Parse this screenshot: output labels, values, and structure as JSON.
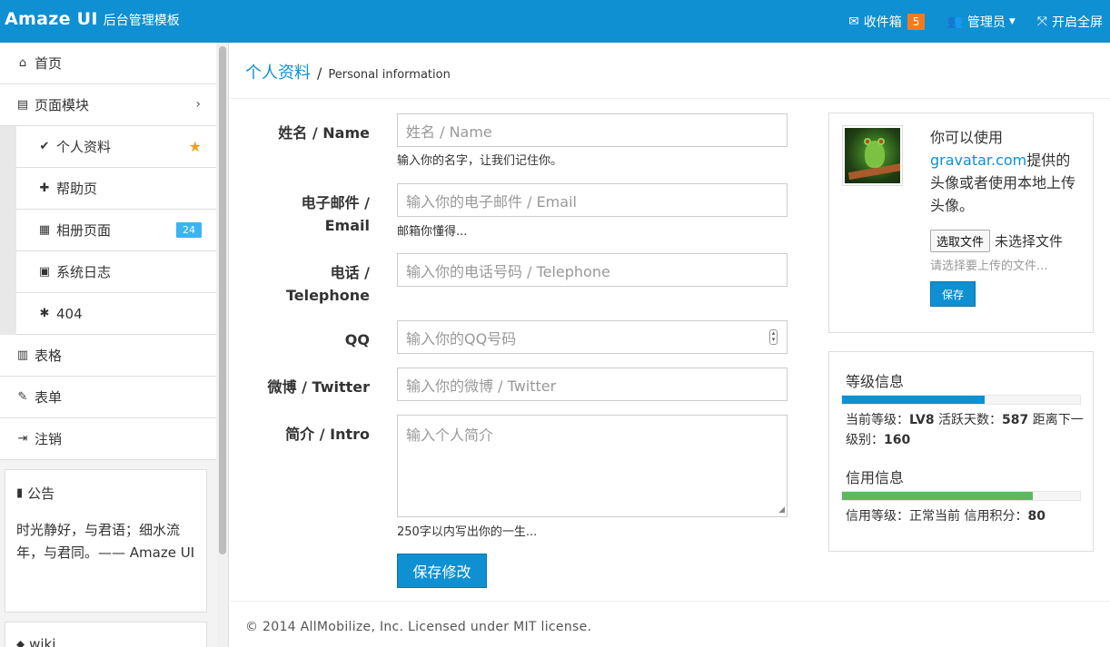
{
  "header": {
    "brand": "Amaze UI",
    "subtitle": "后台管理模板",
    "inbox_label": "收件箱",
    "inbox_count": "5",
    "admin_label": "管理员",
    "fullscreen_label": "开启全屏"
  },
  "sidebar": {
    "items": [
      {
        "label": "首页",
        "icon": "home-icon"
      },
      {
        "label": "页面模块",
        "icon": "file-icon"
      },
      {
        "label": "个人资料",
        "icon": "check-icon"
      },
      {
        "label": "帮助页",
        "icon": "puzzle-icon"
      },
      {
        "label": "相册页面",
        "icon": "grid-icon",
        "badge": "24"
      },
      {
        "label": "系统日志",
        "icon": "calendar-icon"
      },
      {
        "label": "404",
        "icon": "bug-icon"
      },
      {
        "label": "表格",
        "icon": "table-icon"
      },
      {
        "label": "表单",
        "icon": "edit-icon"
      },
      {
        "label": "注销",
        "icon": "sign-out-icon"
      }
    ],
    "notice": {
      "title": "公告",
      "body": "时光静好，与君语；细水流年，与君同。—— Amaze UI"
    },
    "wiki": {
      "title": "wiki"
    }
  },
  "page": {
    "title_zh": "个人资料",
    "title_sep": "/",
    "title_en": "Personal information"
  },
  "form": {
    "name_label": "姓名 / Name",
    "name_placeholder": "姓名 / Name",
    "name_help": "输入你的名字，让我们记住你。",
    "email_label_1": "电子邮件 /",
    "email_label_2": "Email",
    "email_placeholder": "输入你的电子邮件 / Email",
    "email_help": "邮箱你懂得...",
    "phone_label_1": "电话 /",
    "phone_label_2": "Telephone",
    "phone_placeholder": "输入你的电话号码 / Telephone",
    "qq_label": "QQ",
    "qq_placeholder": "输入你的QQ号码",
    "weibo_label": "微博 / Twitter",
    "weibo_placeholder": "输入你的微博 / Twitter",
    "intro_label": "简介 / Intro",
    "intro_placeholder": "输入个人简介",
    "intro_help": "250字以内写出你的一生...",
    "submit_label": "保存修改"
  },
  "profile_card": {
    "text_before": "你可以使用",
    "link": "gravatar.com",
    "text_after": "提供的头像或者使用本地上传头像。",
    "file_button": "选取文件",
    "file_status": "未选择文件",
    "file_help": "请选择要上传的文件...",
    "save_label": "保存"
  },
  "level_card": {
    "level_title": "等级信息",
    "level_progress": 0.6,
    "level_color": "#0e90d2",
    "level_prefix": "当前等级：",
    "level_value": "LV8",
    "active_prefix": "活跃天数：",
    "active_value": "587",
    "next_prefix": "距离下一级别：",
    "next_value": "160",
    "credit_title": "信用信息",
    "credit_progress": 0.8,
    "credit_color": "#5eb95e",
    "credit_prefix": "信用等级：正常当前 信用积分：",
    "credit_value": "80"
  },
  "footer": {
    "text": "© 2014 AllMobilize, Inc. Licensed under MIT license."
  }
}
